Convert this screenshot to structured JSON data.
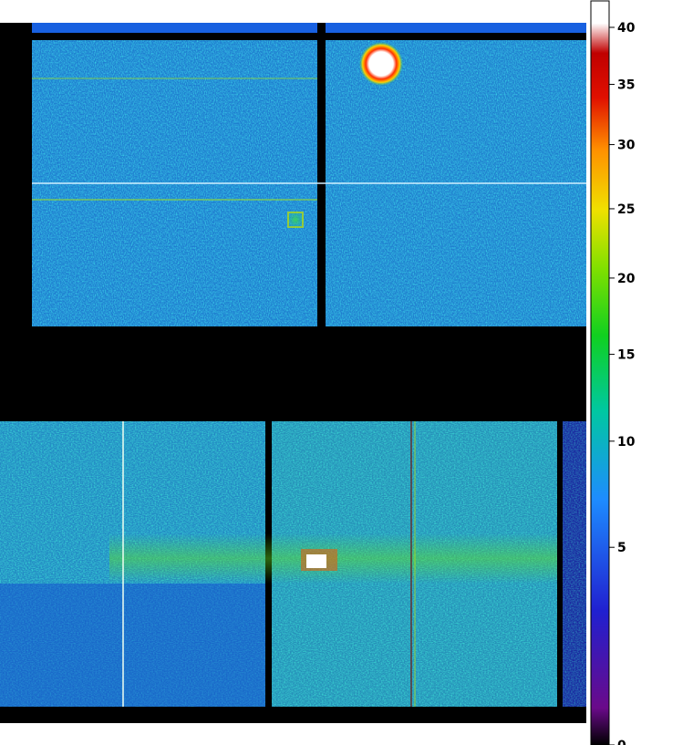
{
  "colorbar": {
    "ticks": [
      {
        "value": 40,
        "label": "40"
      },
      {
        "value": 35,
        "label": "35"
      },
      {
        "value": 30,
        "label": "30"
      },
      {
        "value": 25,
        "label": "25"
      },
      {
        "value": 20,
        "label": "20"
      },
      {
        "value": 15,
        "label": "15"
      },
      {
        "value": 10,
        "label": "10"
      },
      {
        "value": 5,
        "label": "5"
      },
      {
        "value": 0,
        "label": "0"
      }
    ],
    "colors": [
      "#000000",
      "#6a0a8a",
      "#2020d0",
      "#1e8cff",
      "#00c8a0",
      "#10d020",
      "#80e000",
      "#f0e000",
      "#ff9000",
      "#e01000",
      "#c00000",
      "#ffffff"
    ]
  }
}
